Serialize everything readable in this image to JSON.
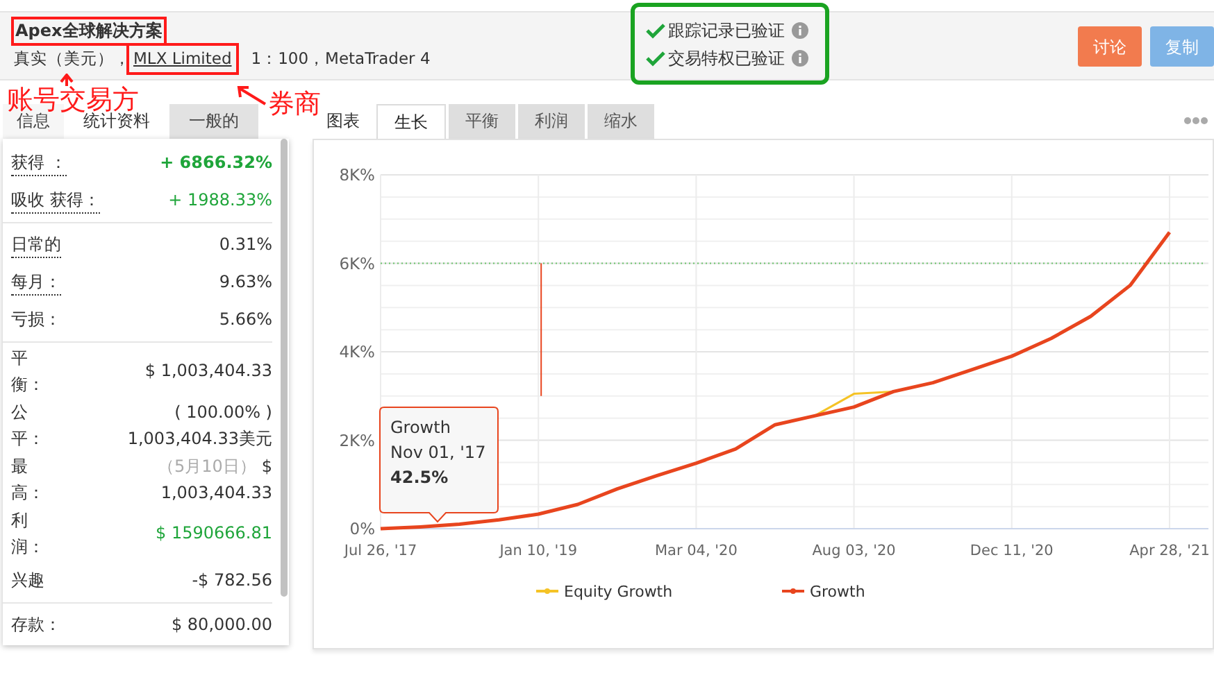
{
  "account": {
    "title": "Apex全球解决方案",
    "type": "真实（美元），",
    "broker": "MLX Limited",
    "details": "1：100，MetaTrader 4",
    "title_highlighted": true,
    "broker_highlighted": true
  },
  "annotations": [
    {
      "kind": "callout",
      "text": "账号交易方"
    },
    {
      "kind": "callout",
      "text": "券商"
    }
  ],
  "verification": {
    "highlighted": true,
    "items": [
      {
        "label": "跟踪记录已验证",
        "verified": true
      },
      {
        "label": "交易特权已验证",
        "verified": true
      }
    ]
  },
  "buttons": [
    {
      "label": "讨论",
      "kind": "primary"
    },
    {
      "label": "复制",
      "kind": "secondary"
    }
  ],
  "stats_tabs": [
    {
      "label": "信息",
      "selected": false
    },
    {
      "label": "统计资料",
      "selected": true
    },
    {
      "label": "一般的",
      "selected": false
    }
  ],
  "stats_sections": [
    {
      "rows": [
        {
          "label": "获得 ：",
          "dotted": true,
          "kind": "single",
          "values": [
            {
              "text": "+ 6866.32%",
              "color": "#1fa53a",
              "bold": true
            }
          ]
        },
        {
          "label": "吸收 获得：",
          "dotted": true,
          "kind": "single",
          "values": [
            {
              "text": "+ 1988.33%",
              "color": "#1fa53a",
              "bold": false
            }
          ]
        }
      ]
    },
    {
      "rows": [
        {
          "label": "日常的",
          "dotted": true,
          "kind": "single",
          "values": [
            {
              "text": "0.31%",
              "color": "#333333",
              "bold": false
            }
          ]
        },
        {
          "label": "每月：",
          "dotted": true,
          "kind": "single",
          "values": [
            {
              "text": "9.63%",
              "color": "#333333",
              "bold": false
            }
          ]
        },
        {
          "label": "亏损：",
          "dotted": false,
          "kind": "single",
          "values": [
            {
              "text": "5.66%",
              "color": "#333333",
              "bold": false
            }
          ]
        }
      ]
    },
    {
      "rows": [
        {
          "label": "平衡：",
          "dotted": false,
          "kind": "stacked",
          "values": [
            {
              "text": "$ 1,003,404.33",
              "color": "#333333",
              "bold": false
            }
          ]
        },
        {
          "label": "公平：",
          "dotted": false,
          "kind": "stacked",
          "values": [
            {
              "text": "( 100.00% )",
              "color": "#333333",
              "bold": false
            },
            {
              "text": "1,003,404.33美元",
              "color": "#333333",
              "bold": false
            }
          ]
        },
        {
          "label": "最高：",
          "dotted": false,
          "kind": "stacked",
          "values": [
            {
              "text": "（5月10日）",
              "color": "#aaaaaa",
              "bold": false,
              "suffix": "$"
            },
            {
              "text": "1,003,404.33",
              "color": "#333333",
              "bold": false
            }
          ]
        },
        {
          "label": "利润：",
          "dotted": false,
          "kind": "stacked",
          "values": [
            {
              "text": "$ 1590666.81",
              "color": "#1fa53a",
              "bold": false
            }
          ]
        },
        {
          "label": "兴趣",
          "dotted": false,
          "kind": "single",
          "values": [
            {
              "text": "-$ 782.56",
              "color": "#333333",
              "bold": false
            }
          ]
        }
      ]
    },
    {
      "rows": [
        {
          "label": "存款：",
          "dotted": false,
          "kind": "single",
          "values": [
            {
              "text": "$ 80,000.00",
              "color": "#333333",
              "bold": false
            }
          ]
        }
      ]
    }
  ],
  "chart_tabs": [
    {
      "label": "图表",
      "kind": "title"
    },
    {
      "label": "生长",
      "kind": "tab",
      "selected": true
    },
    {
      "label": "平衡",
      "kind": "tab",
      "selected": false
    },
    {
      "label": "利润",
      "kind": "tab",
      "selected": false
    },
    {
      "label": "缩水",
      "kind": "tab",
      "selected": false
    }
  ],
  "chart": {
    "tooltip": {
      "series": "Growth",
      "date": "Nov 01, '17",
      "value": "42.5%"
    },
    "chart_data": {
      "type": "line",
      "categories": [
        "Jul 26, '17",
        null,
        null,
        null,
        "Jan 10, '19",
        null,
        null,
        null,
        "Mar 04, '20",
        null,
        null,
        null,
        "Aug 03, '20",
        null,
        null,
        null,
        "Dec 11, '20",
        null,
        null,
        null,
        "Apr 28, '21"
      ],
      "series": [
        {
          "name": "Equity Growth",
          "color": "#f5c326",
          "values": [
            null,
            null,
            null,
            null,
            null,
            null,
            null,
            null,
            null,
            null,
            null,
            2550,
            3050,
            3100,
            null,
            null,
            null,
            null,
            null,
            null,
            null
          ]
        },
        {
          "name": "Growth",
          "color": "#e8451e",
          "values": [
            0,
            40,
            100,
            200,
            330,
            550,
            900,
            1200,
            1480,
            1800,
            2350,
            2550,
            2750,
            3100,
            3300,
            3600,
            3900,
            4300,
            4800,
            5500,
            6700
          ]
        }
      ],
      "ylim": [
        0,
        8000
      ],
      "grid": true,
      "legend": true,
      "ref_lines": [
        {
          "axis": "y",
          "value": 6000,
          "color": "#6cc46c"
        }
      ],
      "yticks": [
        {
          "value": 0,
          "label": "0%"
        },
        {
          "value": 2000,
          "label": "2K%"
        },
        {
          "value": 4000,
          "label": "4K%"
        },
        {
          "value": 6000,
          "label": "6K%"
        },
        {
          "value": 8000,
          "label": "8K%"
        }
      ]
    }
  }
}
